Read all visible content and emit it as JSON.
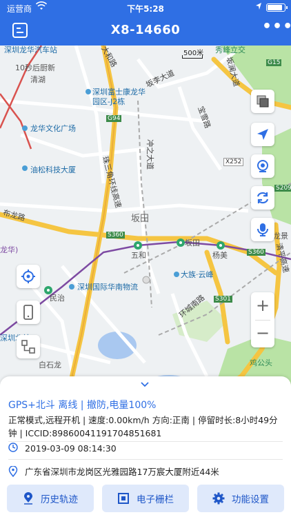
{
  "status_bar": {
    "carrier": "运营商",
    "time": "下午5:28",
    "battery_level": 0.9
  },
  "nav": {
    "title": "X8-14660",
    "left_icon": "list-icon",
    "right_icon": "more-icon"
  },
  "map": {
    "scale_label": "500米",
    "labels": {
      "shenzhen_longhua_auto": "深圳龙华汽车站",
      "ten_sec_breakfast": "10秒后厨新",
      "qingxi": "清湖",
      "dahe_road": "大和路",
      "banli_road": "坂李大道",
      "bianlan_avenue": "坂澜大道",
      "foxconn": "深圳富士康龙华",
      "foxconn_2": "园区-J2栋",
      "longhua_plaza": "龙华文化广场",
      "youzi_building": "油松科技大厦",
      "baolong_road": "宝雪路",
      "chongzhi": "冲之大道",
      "zhusan_highway": "珠三角环线高速",
      "bantian": "坂田",
      "bulong_road": "布龙路",
      "wuhe": "五和",
      "bantian_station": "坂田",
      "yangmei": "杨美",
      "dazu": "大族·云峰",
      "intl_logistics": "深圳国际华南物流",
      "mingzhi": "民治",
      "huannan_road": "环城南路",
      "longjing": "龙景",
      "qingping": "清平高速",
      "jigongtou": "鸡公头",
      "baishi_road": "白石龙",
      "longhua_zone": "龙华)",
      "shenzhen_north": "深圳北站",
      "xiuzhen": "秀峰立交",
      "g94": "G94",
      "x252": "X252",
      "s209": "S209",
      "s301": "S301",
      "s360": "S360",
      "s360b": "S360",
      "g15": "G15"
    },
    "tools": [
      "layers-icon",
      "locate-arrow-icon",
      "camera-icon",
      "refresh-icon",
      "microphone-icon"
    ],
    "left_tools": [
      "target-icon",
      "phone-icon",
      "network-icon"
    ],
    "zoom_in": "+",
    "zoom_out": "−",
    "colors": {
      "primary": "#2f6fe4",
      "highway": "#f5c542",
      "green": "#b9e3a5"
    }
  },
  "panel": {
    "status_line": "GPS+北斗 离线 | 撤防,电量100%",
    "detail_line": "正常模式,远程开机 | 速度:0.00km/h 方向:正南 | 停留时长:8小时49分钟 | ICCID:89860041191704851681",
    "timestamp": "2019-03-09 08:14:30",
    "address": "广东省深圳市龙岗区光雅园路17万宸大厦附近44米",
    "buttons": [
      {
        "label": "历史轨迹",
        "icon": "location-pin-icon"
      },
      {
        "label": "电子栅栏",
        "icon": "fence-icon"
      },
      {
        "label": "功能设置",
        "icon": "gear-icon"
      }
    ]
  }
}
